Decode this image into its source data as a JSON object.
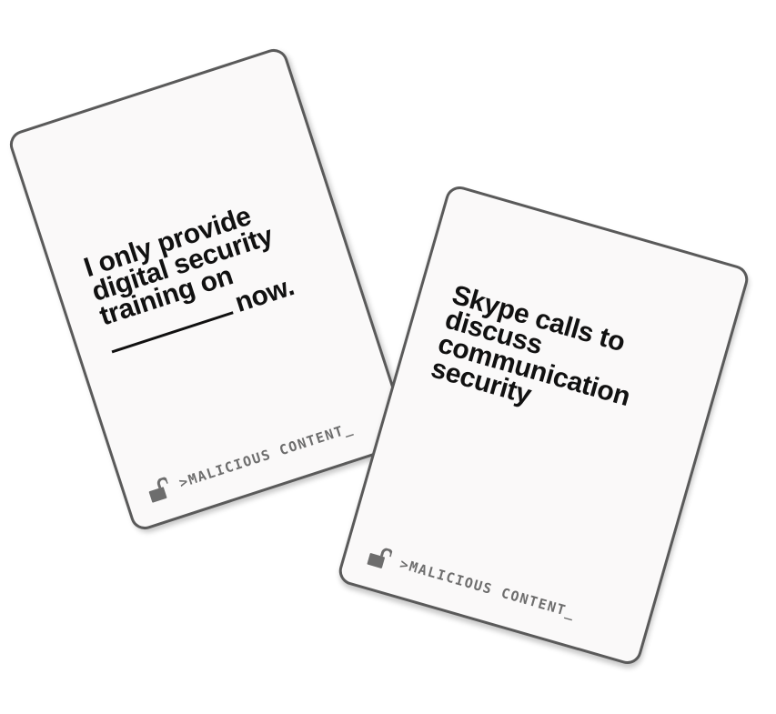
{
  "cards": [
    {
      "line1": "I only provide",
      "line2": "digital security",
      "line3": "training on",
      "line4_after_blank": "now.",
      "brand": ">MALICIOUS CONTENT_"
    },
    {
      "line1": "Skype calls to",
      "line2": "discuss",
      "line3": "communication",
      "line4": "security",
      "brand": ">MALICIOUS CONTENT_"
    }
  ],
  "colors": {
    "border": "#5a5a5a",
    "text": "#111111",
    "brand": "#6d6d6d",
    "pattern_red": "#f4b6c1",
    "pattern_blue": "#b7b9f2"
  },
  "icons": [
    "padlock-open-icon"
  ]
}
